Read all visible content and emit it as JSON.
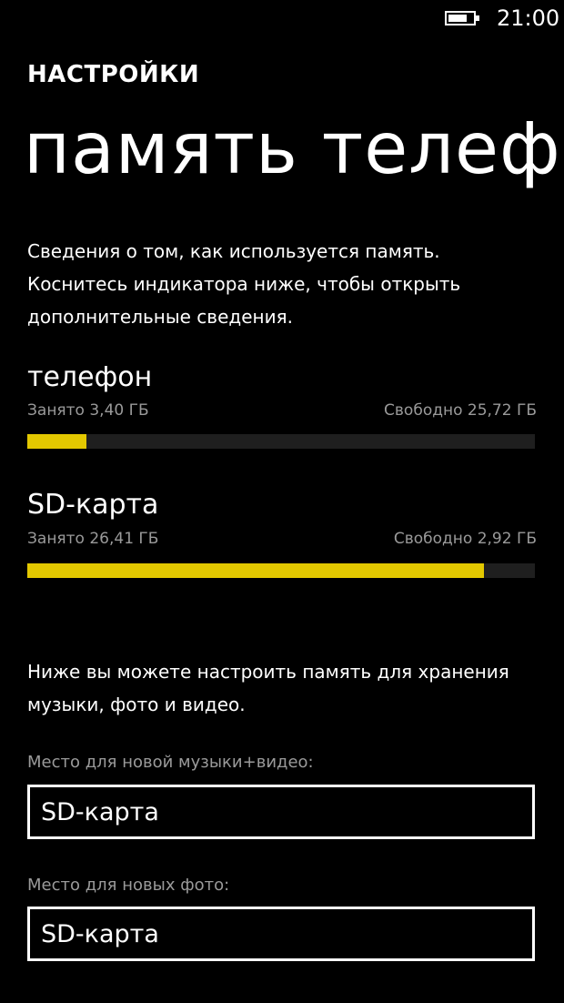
{
  "status_bar": {
    "time": "21:00",
    "battery_icon": "battery-icon",
    "battery_level": 0.75
  },
  "header": {
    "app_title": "НАСТРОЙКИ",
    "page_title": "память телефона"
  },
  "intro": {
    "lines": [
      "Сведения о том, как используется память.",
      "Коснитесь индикатора ниже, чтобы открыть",
      "дополнительные сведения."
    ]
  },
  "storage": [
    {
      "name": "телефон",
      "used": "Занято 3,40 ГБ",
      "free": "Свободно 25,72 ГБ",
      "used_fraction": 0.1168
    },
    {
      "name": "SD-карта",
      "used": "Занято 26,41 ГБ",
      "free": "Свободно 2,92 ГБ",
      "used_fraction": 0.9004
    }
  ],
  "settings_note": {
    "lines": [
      "Ниже вы можете настроить память для хранения",
      "музыки, фото и видео."
    ]
  },
  "pickers": [
    {
      "label": "Место для новой музыки+видео:",
      "value": "SD-карта"
    },
    {
      "label": "Место для новых фото:",
      "value": "SD-карта"
    }
  ],
  "colors": {
    "accent": "#e3c800",
    "background": "#000000",
    "track": "#1f1f1f",
    "secondary_text": "#9a9a9a"
  }
}
